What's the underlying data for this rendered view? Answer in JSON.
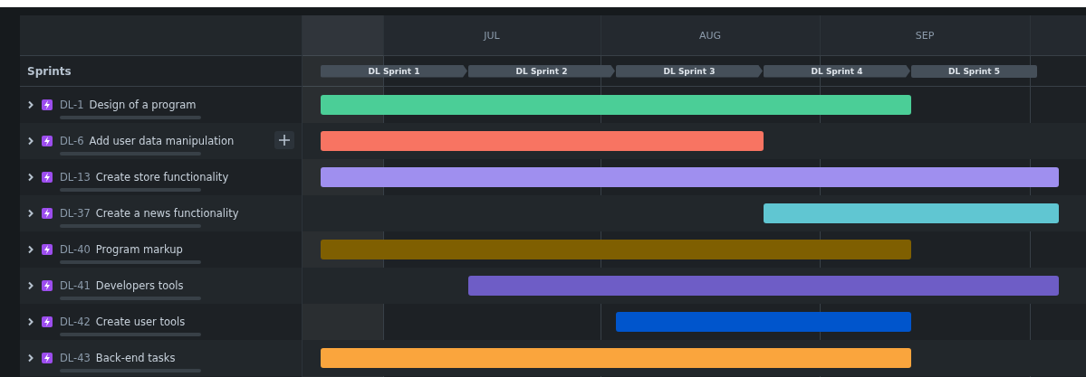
{
  "months": [
    "JUL",
    "AUG",
    "SEP"
  ],
  "sprints_label": "Sprints",
  "sprints": [
    "DL Sprint 1",
    "DL Sprint 2",
    "DL Sprint 3",
    "DL Sprint 4",
    "DL Sprint 5"
  ],
  "rows": [
    {
      "key": "DL-1",
      "title": "Design of a program",
      "add_button": false,
      "level": 0,
      "color": "#4bce97",
      "sprints": [
        true,
        true,
        true,
        true,
        false
      ]
    },
    {
      "key": "DL-6",
      "title": "Add user data manipulation",
      "add_button": true,
      "level": 0,
      "color": "#f87462",
      "sprints": [
        true,
        true,
        true,
        false,
        false
      ]
    },
    {
      "key": "DL-13",
      "title": "Create store functionality",
      "add_button": false,
      "level": 0,
      "color": "#9f8fef",
      "sprints": [
        true,
        true,
        true,
        true,
        true
      ]
    },
    {
      "key": "DL-37",
      "title": "Create a news functionality",
      "add_button": false,
      "level": 0,
      "color": "#60c6d2",
      "sprints": [
        false,
        false,
        false,
        true,
        true
      ]
    },
    {
      "key": "DL-40",
      "title": "Program markup",
      "add_button": false,
      "level": 0,
      "color": "#7f5f01",
      "sprints": [
        true,
        true,
        true,
        true,
        false
      ]
    },
    {
      "key": "DL-41",
      "title": "Developers tools",
      "add_button": false,
      "level": 0,
      "color": "#6e5dc6",
      "sprints": [
        false,
        true,
        true,
        true,
        true
      ]
    },
    {
      "key": "DL-42",
      "title": "Create user tools",
      "add_button": false,
      "level": 0,
      "color": "#0055cc",
      "sprints": [
        false,
        false,
        true,
        true,
        false
      ]
    },
    {
      "key": "DL-43",
      "title": "Back-end tasks",
      "add_button": false,
      "level": 0,
      "color": "#faa53d",
      "sprints": [
        true,
        true,
        true,
        true,
        false
      ]
    }
  ]
}
